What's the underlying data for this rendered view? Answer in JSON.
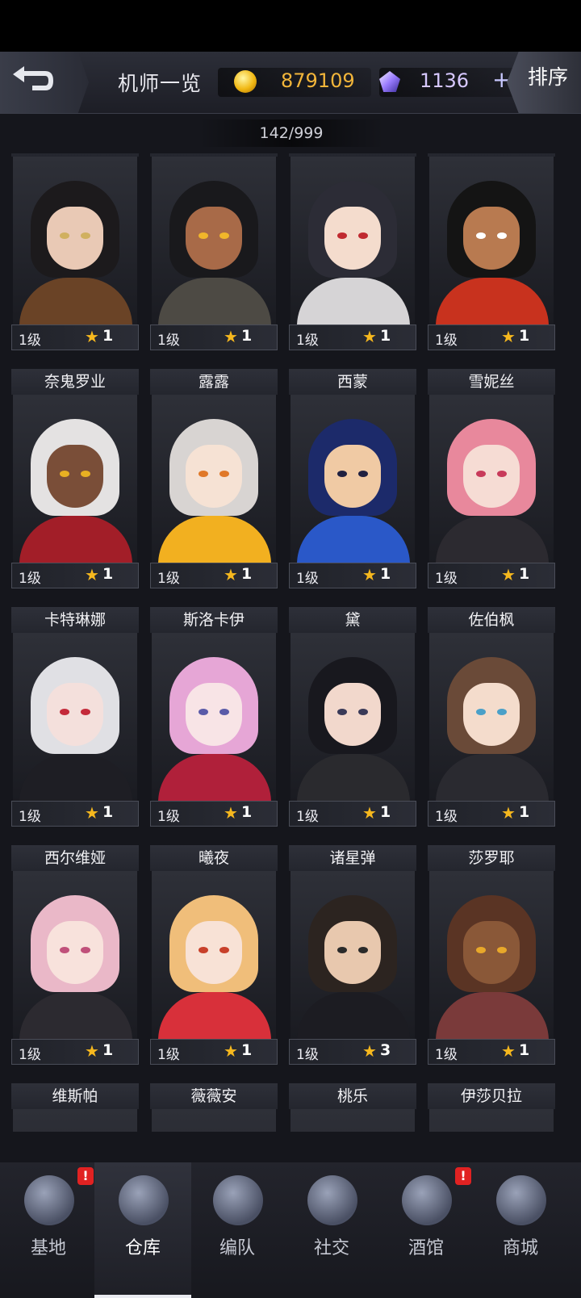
{
  "header": {
    "title": "机师一览",
    "gold": "879109",
    "gems": "1136",
    "plus": "+",
    "sort_label": "排序"
  },
  "counter": "142/999",
  "pilots": [
    {
      "name": "",
      "level": "1级",
      "stars": "1",
      "hair": "#1c1a1c",
      "skin": "#e9c9b5",
      "eyes": "#d0b060",
      "outfit": "#6a4326"
    },
    {
      "name": "",
      "level": "1级",
      "stars": "1",
      "hair": "#19191c",
      "skin": "#a86a48",
      "eyes": "#f0b62a",
      "outfit": "#4d4a44"
    },
    {
      "name": "",
      "level": "1级",
      "stars": "1",
      "hair": "#2c2c36",
      "skin": "#f4dccd",
      "eyes": "#c02a30",
      "outfit": "#d6d4d6"
    },
    {
      "name": "",
      "level": "1级",
      "stars": "1",
      "hair": "#141414",
      "skin": "#b87a50",
      "eyes": "#ffffff",
      "outfit": "#c8321e"
    },
    {
      "name": "奈鬼罗业",
      "level": "1级",
      "stars": "1",
      "hair": "#e4e2e2",
      "skin": "#7a4e38",
      "eyes": "#e8b022",
      "outfit": "#a21e28"
    },
    {
      "name": "露露",
      "level": "1级",
      "stars": "1",
      "hair": "#d8d4d2",
      "skin": "#f6e2d4",
      "eyes": "#e07828",
      "outfit": "#f2b020"
    },
    {
      "name": "西蒙",
      "level": "1级",
      "stars": "1",
      "hair": "#1c2a6a",
      "skin": "#f0caa4",
      "eyes": "#202040",
      "outfit": "#2a58c8"
    },
    {
      "name": "雪妮丝",
      "level": "1级",
      "stars": "1",
      "hair": "#e8889c",
      "skin": "#f6dcd4",
      "eyes": "#c83a5a",
      "outfit": "#2c2a30"
    },
    {
      "name": "卡特琳娜",
      "level": "1级",
      "stars": "1",
      "hair": "#e0e0e4",
      "skin": "#f4e0dc",
      "eyes": "#c42a3a",
      "outfit": "#1e1e24"
    },
    {
      "name": "斯洛卡伊",
      "level": "1级",
      "stars": "1",
      "hair": "#e6a6d6",
      "skin": "#f8e4e6",
      "eyes": "#5a5aa8",
      "outfit": "#b0203a"
    },
    {
      "name": "黛",
      "level": "1级",
      "stars": "1",
      "hair": "#18181e",
      "skin": "#f2d8cc",
      "eyes": "#3a3a58",
      "outfit": "#2a2a2e"
    },
    {
      "name": "佐伯枫",
      "level": "1级",
      "stars": "1",
      "hair": "#6a4a38",
      "skin": "#f4dccc",
      "eyes": "#4aa0c8",
      "outfit": "#2a2a30"
    },
    {
      "name": "西尔维娅",
      "level": "1级",
      "stars": "1",
      "hair": "#eab8c8",
      "skin": "#f8e2dc",
      "eyes": "#c0507a",
      "outfit": "#2c2a30"
    },
    {
      "name": "曦夜",
      "level": "1级",
      "stars": "1",
      "hair": "#f0be7a",
      "skin": "#f8e2d6",
      "eyes": "#c8402a",
      "outfit": "#d8303a"
    },
    {
      "name": "诸星弹",
      "level": "1级",
      "stars": "3",
      "hair": "#2c2420",
      "skin": "#e8c8ae",
      "eyes": "#2a2a2a",
      "outfit": "#1c1c22"
    },
    {
      "name": "莎罗耶",
      "level": "1级",
      "stars": "1",
      "hair": "#5a3424",
      "skin": "#8a5838",
      "eyes": "#e8a82a",
      "outfit": "#7a3a3a"
    },
    {
      "name": "维斯帕",
      "level": "",
      "stars": "",
      "hair": "#9a9a9e",
      "skin": "#e8d8d0",
      "eyes": "#444",
      "outfit": "#333"
    },
    {
      "name": "薇薇安",
      "level": "",
      "stars": "",
      "hair": "#e8a8b8",
      "skin": "#f4dcd4",
      "eyes": "#444",
      "outfit": "#333"
    },
    {
      "name": "桃乐",
      "level": "",
      "stars": "",
      "hair": "#f2d88a",
      "skin": "#f4dcd4",
      "eyes": "#444",
      "outfit": "#333"
    },
    {
      "name": "伊莎贝拉",
      "level": "",
      "stars": "",
      "hair": "#dcdce4",
      "skin": "#f4dcd4",
      "eyes": "#444",
      "outfit": "#333"
    }
  ],
  "nav": [
    {
      "label": "基地",
      "icon": "base-icon",
      "badge": "!"
    },
    {
      "label": "仓库",
      "icon": "warehouse-icon",
      "badge": ""
    },
    {
      "label": "编队",
      "icon": "formation-icon",
      "badge": ""
    },
    {
      "label": "社交",
      "icon": "handshake-icon",
      "badge": ""
    },
    {
      "label": "酒馆",
      "icon": "tavern-icon",
      "badge": "!"
    },
    {
      "label": "商城",
      "icon": "shop-icon",
      "badge": ""
    }
  ],
  "active_nav": 1
}
